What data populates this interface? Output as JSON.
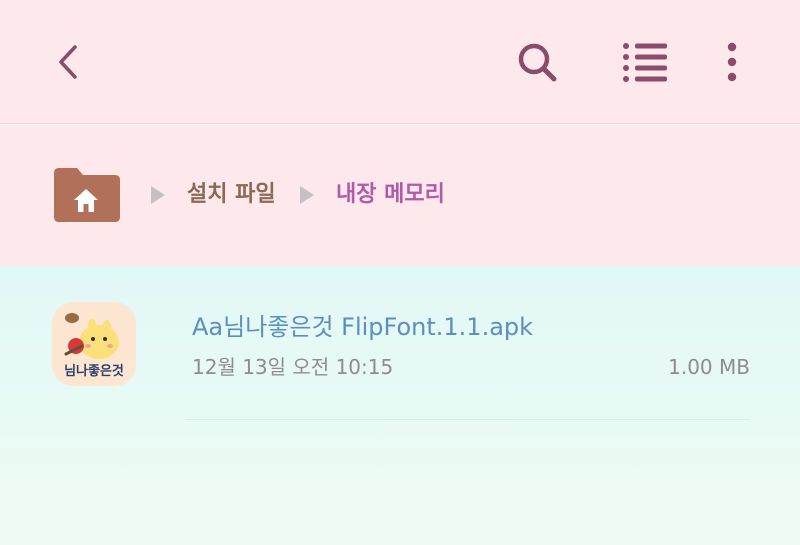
{
  "header": {
    "back_icon": "chevron-left-icon",
    "search_icon": "search-icon",
    "list_icon": "list-view-icon",
    "more_icon": "more-vertical-icon",
    "icon_color": "#8b4b6b"
  },
  "breadcrumb": {
    "home_icon": "home-folder-icon",
    "items": [
      {
        "label": "설치 파일",
        "color": "#8a6a57"
      },
      {
        "label": "내장 메모리",
        "color": "#b05aaa"
      }
    ]
  },
  "files": [
    {
      "thumbnail_text": "님나좋은것",
      "name": "Aa님나좋은것 FlipFont.1.1.apk",
      "date": "12월 13일 오전 10:15",
      "size": "1.00 MB"
    }
  ]
}
